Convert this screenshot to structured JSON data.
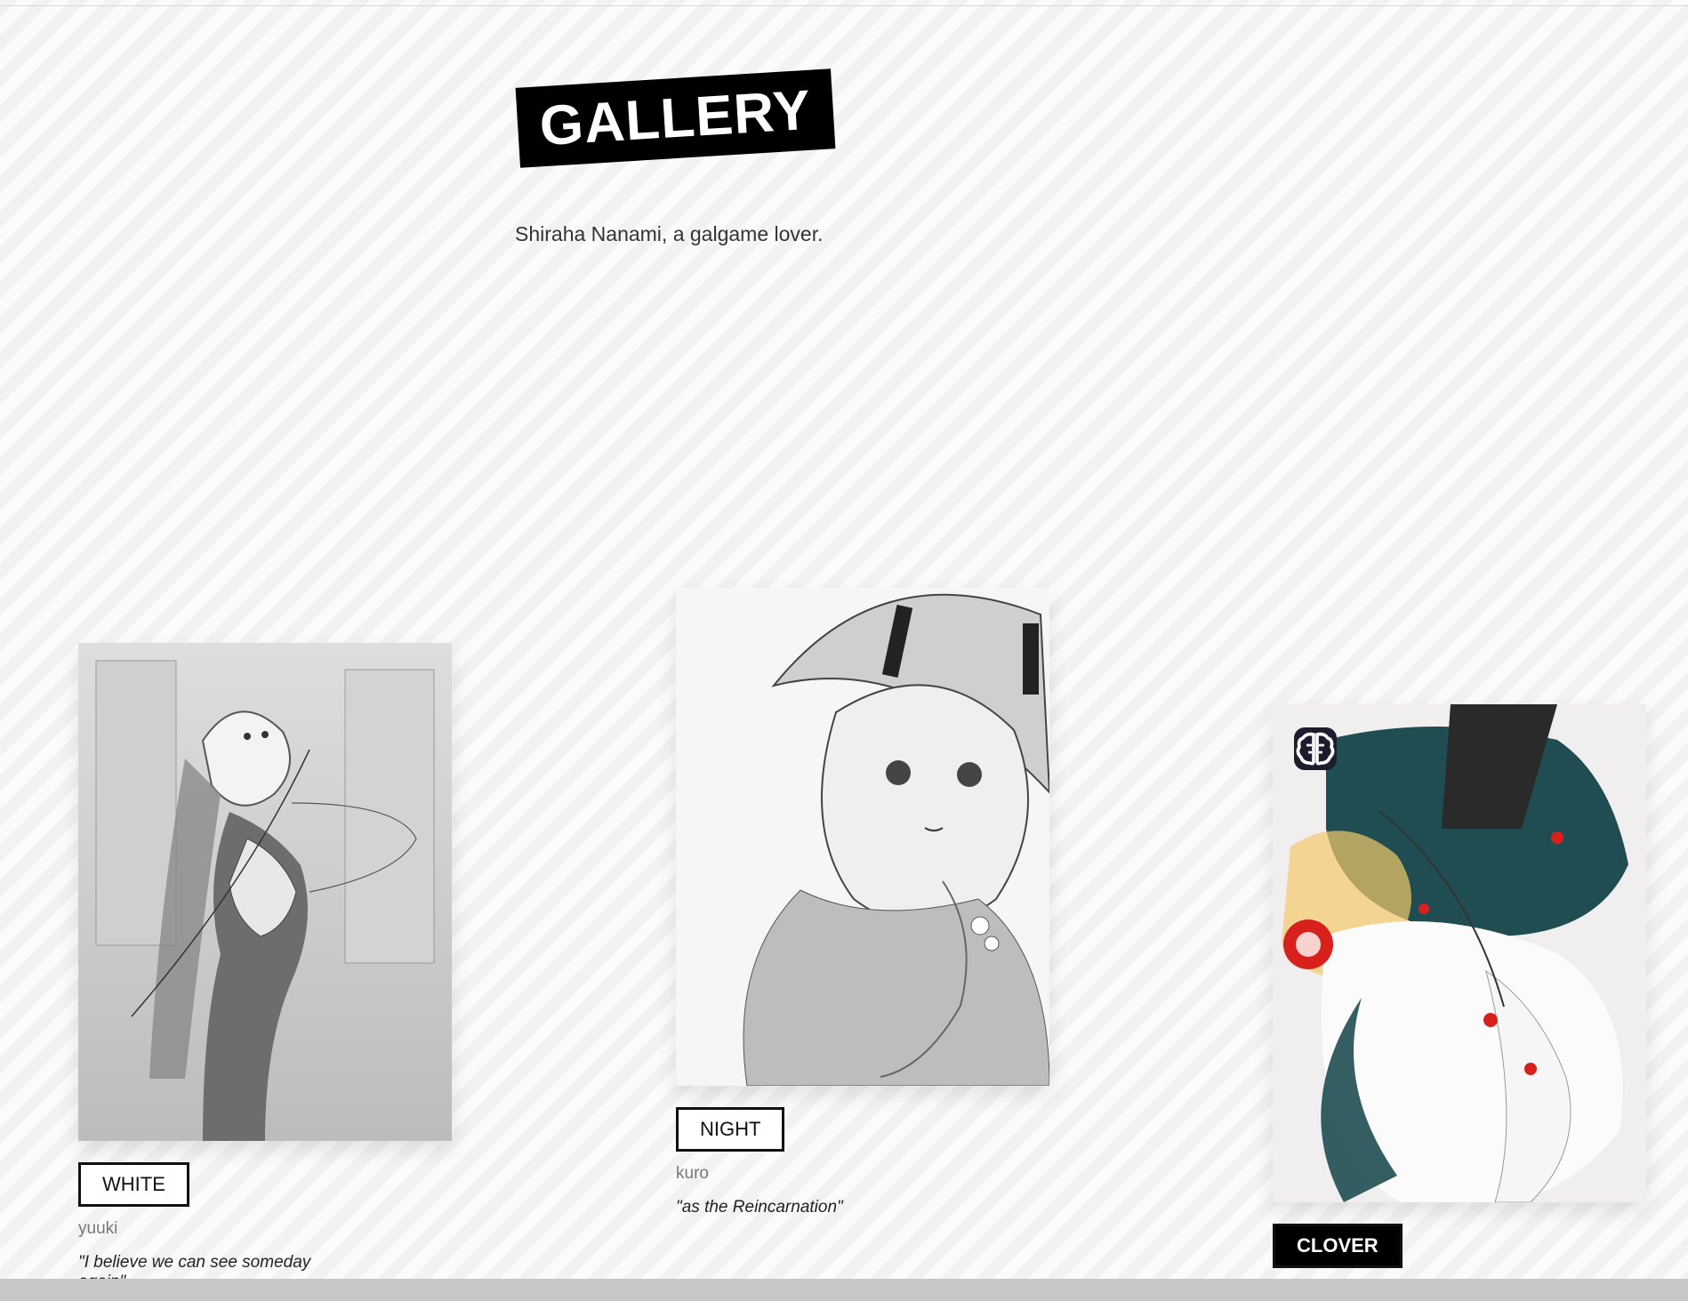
{
  "header": {
    "title": "GALLERY",
    "subtitle": "Shiraha Nanami, a galgame lover."
  },
  "cards": [
    {
      "tag": "WHITE",
      "author": "yuuki",
      "quote": "\"I believe we can see someday again\""
    },
    {
      "tag": "NIGHT",
      "author": "kuro",
      "quote": "\"as the Reincarnation\""
    },
    {
      "tag": "CLOVER"
    }
  ],
  "icons": {
    "ai_badge": "brain-icon"
  },
  "colors": {
    "title_bg": "#000000",
    "title_text": "#ffffff",
    "badge_bg": "#1c1c2e",
    "accent_red": "#d8211c",
    "teal": "#1f4d52"
  }
}
